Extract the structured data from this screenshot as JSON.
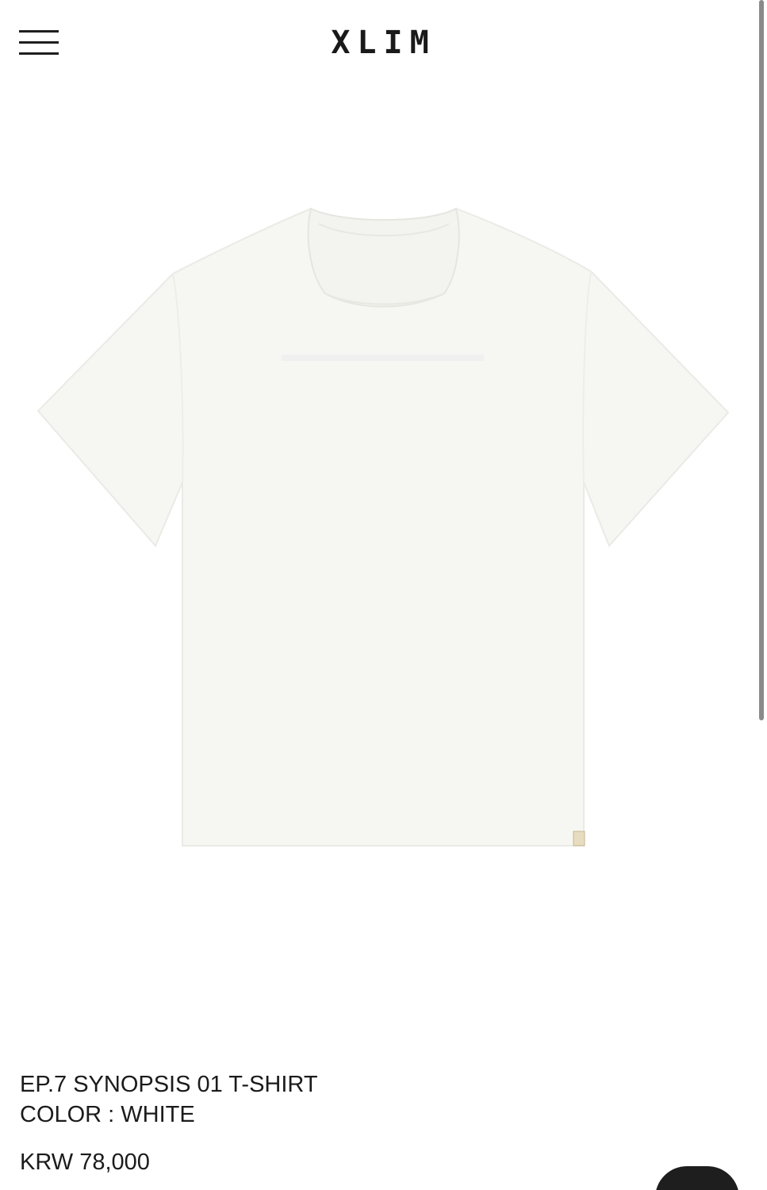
{
  "header": {
    "logo": "XLIM",
    "menu_icon": "hamburger-menu-icon"
  },
  "product": {
    "image_description_icon": "product-photo",
    "name": "EP.7 SYNOPSIS 01 T-SHIRT",
    "color": "COLOR : WHITE",
    "price": "KRW 78,000"
  },
  "colors": {
    "text": "#1a1a1a",
    "background": "#ffffff",
    "shirt": "#f6f7f3"
  }
}
